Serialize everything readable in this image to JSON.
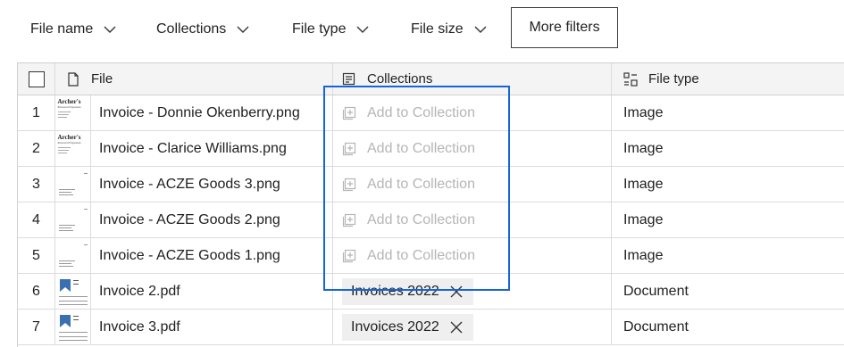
{
  "filters": {
    "file_name": "File name",
    "collections": "Collections",
    "file_type": "File type",
    "file_size": "File size",
    "more_filters": "More filters"
  },
  "table": {
    "headers": {
      "file": "File",
      "collections": "Collections",
      "file_type": "File type"
    },
    "rows": [
      {
        "num": "1",
        "file": "Invoice - Donnie Okenberry.png",
        "collection": "Add to Collection",
        "type": "Image",
        "thumb": "archer",
        "thumb_title": "Archer's",
        "thumb_sub": "Personal Expenses"
      },
      {
        "num": "2",
        "file": "Invoice - Clarice Williams.png",
        "collection": "Add to Collection",
        "type": "Image",
        "thumb": "archer",
        "thumb_title": "Archer's",
        "thumb_sub": "Personal Expenses"
      },
      {
        "num": "3",
        "file": "Invoice - ACZE Goods 3.png",
        "collection": "Add to Collection",
        "type": "Image",
        "thumb": "acze"
      },
      {
        "num": "4",
        "file": "Invoice - ACZE Goods 2.png",
        "collection": "Add to Collection",
        "type": "Image",
        "thumb": "acze"
      },
      {
        "num": "5",
        "file": "Invoice - ACZE Goods 1.png",
        "collection": "Add to Collection",
        "type": "Image",
        "thumb": "acze"
      },
      {
        "num": "6",
        "file": "Invoice 2.pdf",
        "collection_chip": "Invoices 2022",
        "type": "Document",
        "thumb": "pdf"
      },
      {
        "num": "7",
        "file": "Invoice 3.pdf",
        "collection_chip": "Invoices 2022",
        "type": "Document",
        "thumb": "pdf"
      }
    ]
  },
  "colors": {
    "highlight": "#1565d8",
    "placeholder_text": "#b5b5b5",
    "chip_bg": "#efefef",
    "header_bg": "#f4f4f4"
  }
}
